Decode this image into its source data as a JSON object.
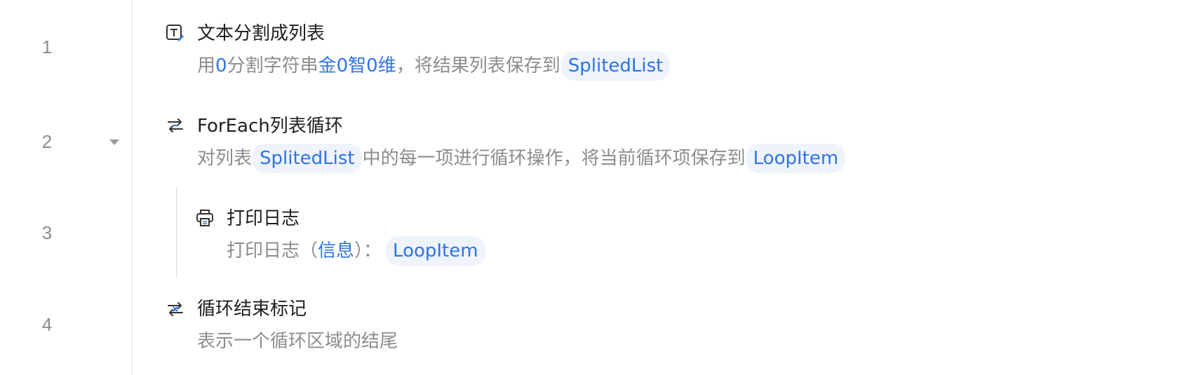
{
  "line_numbers": [
    "1",
    "2",
    "3",
    "4"
  ],
  "steps": [
    {
      "title": "文本分割成列表",
      "icon": "text-split-icon",
      "desc": {
        "p1": "用",
        "sep": "0",
        "p2": "分割字符串",
        "src_a": "金",
        "src_b": "0",
        "src_c": "智",
        "src_d": "0",
        "src_e": "维",
        "p3": "，将结果列表保存到",
        "var": "SplitedList"
      }
    },
    {
      "title": "ForEach列表循环",
      "icon": "loop-icon",
      "desc": {
        "p1": "对列表",
        "var1": "SplitedList",
        "p2": "中的每一项进行循环操作，将当前循环项保存到",
        "var2": "LoopItem"
      }
    },
    {
      "title": "打印日志",
      "icon": "printer-icon",
      "desc": {
        "p1": "打印日志（",
        "level": "信息",
        "p2": "）：",
        "var": "LoopItem"
      }
    },
    {
      "title": "循环结束标记",
      "icon": "loop-end-icon",
      "desc": {
        "p1": "表示一个循环区域的结尾"
      }
    }
  ],
  "colors": {
    "accent": "#2e74e6",
    "pill_bg": "#eef3fc",
    "muted_text": "#8c8c8c",
    "title_text": "#1f1f1f"
  }
}
